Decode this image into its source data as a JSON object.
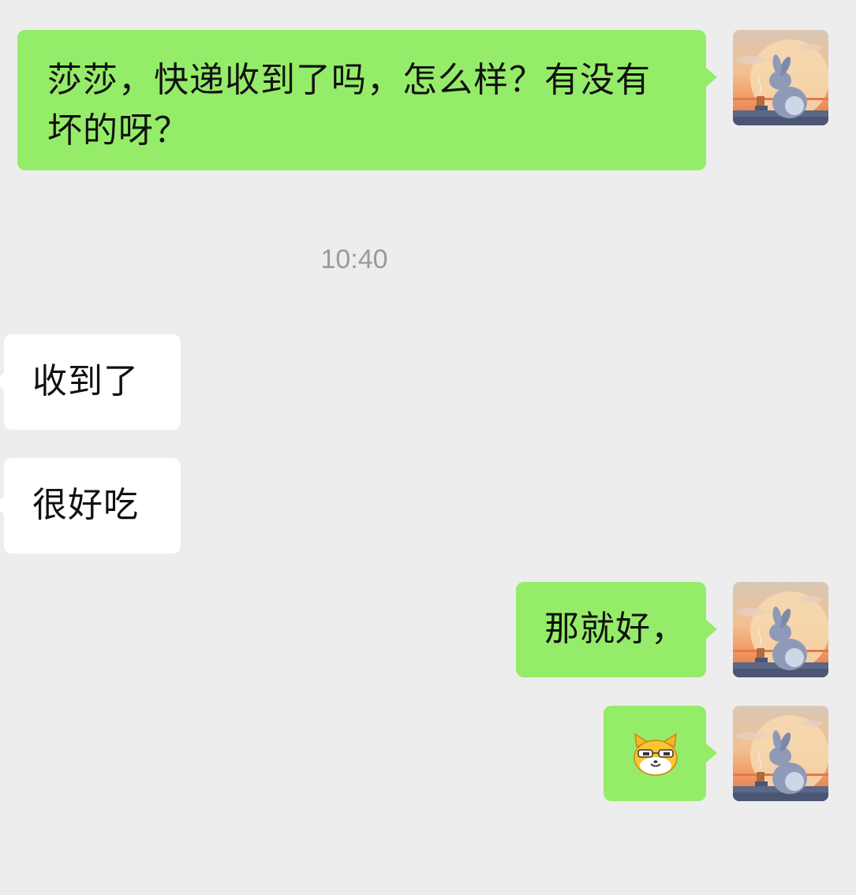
{
  "messages": [
    {
      "direction": "outgoing",
      "text": "莎莎，快递收到了吗，怎么样？有没有坏的呀？"
    },
    {
      "direction": "incoming",
      "text": "收到了"
    },
    {
      "direction": "incoming",
      "text": "很好吃"
    },
    {
      "direction": "outgoing",
      "text": "那就好，"
    },
    {
      "direction": "outgoing",
      "emoji": "cat-sunglasses-emoji"
    }
  ],
  "timestamp": "10:40",
  "colors": {
    "background": "#ededed",
    "outgoing_bubble": "#95ec69",
    "incoming_bubble": "#ffffff",
    "timestamp_text": "#9a9a9a"
  },
  "avatar": {
    "icon": "bunny-sunset-avatar"
  }
}
